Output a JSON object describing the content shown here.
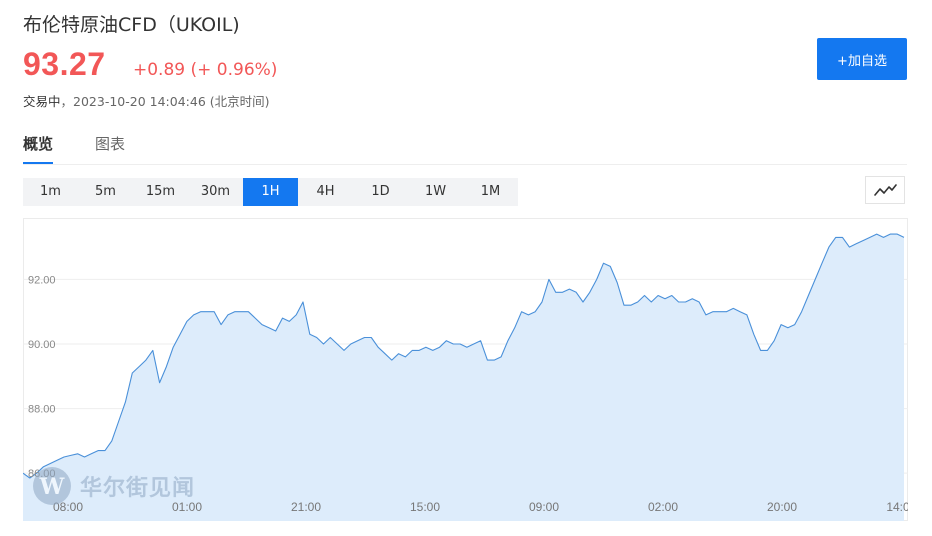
{
  "quote": {
    "title": "布伦特原油CFD（UKOIL)",
    "price": "93.27",
    "change": "+0.89 (+ 0.96%)",
    "status_label": "交易中",
    "timestamp": "，2023-10-20 14:04:46 (北京时间)"
  },
  "actions": {
    "add_watchlist": "+加自选"
  },
  "tabs": [
    {
      "label": "概览"
    },
    {
      "label": "图表"
    }
  ],
  "periods": [
    "1m",
    "5m",
    "15m",
    "30m",
    "1H",
    "4H",
    "1D",
    "1W",
    "1M"
  ],
  "active_period": "1H",
  "watermark": {
    "text": "华尔街见闻"
  },
  "colors": {
    "up": "#f25757",
    "accent": "#1478f0",
    "line": "#4a90d9",
    "area": "#ddecfb"
  },
  "chart_data": {
    "type": "area",
    "title": "",
    "xlabel": "",
    "ylabel": "",
    "x_tick_labels": [
      "08:00",
      "01:00",
      "21:00",
      "15:00",
      "09:00",
      "02:00",
      "20:00",
      "14:0"
    ],
    "y_ticks": [
      86,
      88,
      90,
      92
    ],
    "y_tick_labels": [
      "86.00",
      "88.00",
      "90.00",
      "92.00"
    ],
    "ylim": [
      85.2,
      93.9
    ],
    "grid": "horizontal",
    "series": [
      {
        "values": [
          86.0,
          85.85,
          86.0,
          86.2,
          86.3,
          86.4,
          86.5,
          86.55,
          86.6,
          86.5,
          86.6,
          86.7,
          86.7,
          87.0,
          87.6,
          88.2,
          89.1,
          89.3,
          89.5,
          89.8,
          88.8,
          89.3,
          89.9,
          90.3,
          90.7,
          90.9,
          91.0,
          91.0,
          91.0,
          90.6,
          90.9,
          91.0,
          91.0,
          91.0,
          90.8,
          90.6,
          90.5,
          90.4,
          90.8,
          90.7,
          90.9,
          91.3,
          90.3,
          90.2,
          90.0,
          90.2,
          90.0,
          89.8,
          90.0,
          90.1,
          90.2,
          90.2,
          89.9,
          89.7,
          89.5,
          89.7,
          89.6,
          89.8,
          89.8,
          89.9,
          89.8,
          89.9,
          90.1,
          90.0,
          90.0,
          89.9,
          90.0,
          90.1,
          89.5,
          89.5,
          89.6,
          90.1,
          90.5,
          91.0,
          90.9,
          91.0,
          91.3,
          92.0,
          91.6,
          91.6,
          91.7,
          91.6,
          91.3,
          91.6,
          92.0,
          92.5,
          92.4,
          91.9,
          91.2,
          91.2,
          91.3,
          91.5,
          91.3,
          91.5,
          91.4,
          91.5,
          91.3,
          91.3,
          91.4,
          91.3,
          90.9,
          91.0,
          91.0,
          91.0,
          91.1,
          91.0,
          90.9,
          90.3,
          89.8,
          89.8,
          90.1,
          90.6,
          90.5,
          90.6,
          91.0,
          91.5,
          92.0,
          92.5,
          93.0,
          93.3,
          93.3,
          93.0,
          93.1,
          93.2,
          93.3,
          93.4,
          93.3,
          93.4,
          93.4,
          93.3
        ]
      }
    ]
  }
}
